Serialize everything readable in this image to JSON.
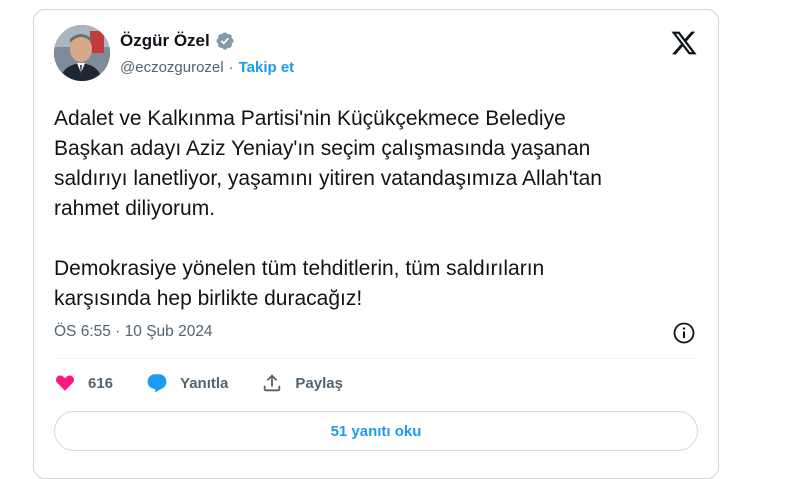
{
  "author": {
    "name": "Özgür Özel",
    "handle": "@eczozgurozel",
    "separator": "·",
    "follow_label": "Takip et"
  },
  "tweet": {
    "text": "Adalet ve Kalkınma Partisi'nin Küçükçekmece Belediye\nBaşkan adayı Aziz Yeniay'ın seçim çalışmasında yaşanan\nsaldırıyı lanetliyor, yaşamını yitiren vatandaşımıza Allah'tan\nrahmet diliyorum.\n\nDemokrasiye yönelen tüm tehditlerin, tüm saldırıların\nkarşısında hep birlikte duracağız!",
    "timestamp": "ÖS 6:55 · 10 Şub 2024"
  },
  "actions": {
    "like_count": "616",
    "reply_label": "Yanıtla",
    "share_label": "Paylaş"
  },
  "read_replies_label": "51 yanıtı oku",
  "icons": {
    "verified": "verified-badge-icon",
    "x_logo": "x-logo-icon",
    "info": "info-icon",
    "heart": "heart-icon",
    "reply": "speech-bubble-icon",
    "share": "share-icon"
  },
  "colors": {
    "accent": "#1d9bf0",
    "like": "#f91880",
    "muted_text": "#536471",
    "border": "#cfd9de"
  }
}
